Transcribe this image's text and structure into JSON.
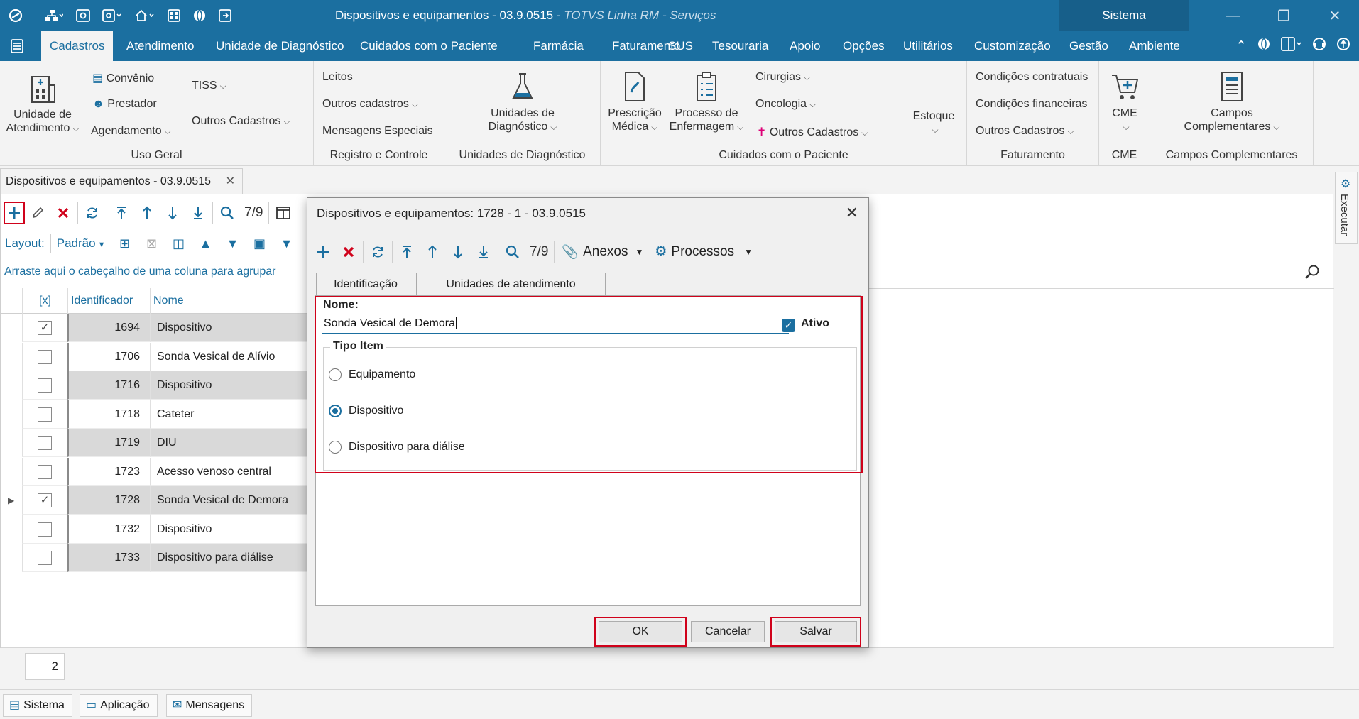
{
  "window": {
    "title": "Dispositivos e equipamentos - 03.9.0515 -",
    "product": "TOTVS Linha RM - Serviços",
    "context": "Sistema"
  },
  "menu": {
    "items": [
      "Cadastros",
      "Atendimento",
      "Unidade de Diagnóstico",
      "Cuidados com o Paciente",
      "Farmácia",
      "Faturamento",
      "SUS",
      "Tesouraria",
      "Apoio",
      "Opções",
      "Utilitários",
      "Customização",
      "Gestão",
      "Ambiente"
    ],
    "active": "Cadastros"
  },
  "ribbon": {
    "uso_geral": {
      "label": "Uso Geral",
      "unidade_line1": "Unidade de",
      "unidade_line2": "Atendimento",
      "convenio": "Convênio",
      "prestador": "Prestador",
      "agendamento": "Agendamento",
      "tiss": "TISS",
      "outros": "Outros Cadastros"
    },
    "registro": {
      "label": "Registro e Controle",
      "leitos": "Leitos",
      "outros": "Outros cadastros",
      "mensagens": "Mensagens Especiais"
    },
    "diagnostico": {
      "label": "Unidades de Diagnóstico",
      "btn_line1": "Unidades de",
      "btn_line2": "Diagnóstico"
    },
    "cuidados": {
      "label": "Cuidados com o Paciente",
      "prescricao_line1": "Prescrição",
      "prescricao_line2": "Médica",
      "processo_line1": "Processo de",
      "processo_line2": "Enfermagem",
      "cirurgias": "Cirurgias",
      "oncologia": "Oncologia",
      "outros": "Outros Cadastros"
    },
    "estoque": {
      "label": "Estoque"
    },
    "faturamento": {
      "label": "Faturamento",
      "contratuais": "Condições contratuais",
      "financeiras": "Condições financeiras",
      "outros": "Outros Cadastros"
    },
    "cme": {
      "label": "CME",
      "btn": "CME"
    },
    "campos": {
      "label": "Campos Complementares",
      "btn_line1": "Campos",
      "btn_line2": "Complementares"
    }
  },
  "doc_tab": {
    "title": "Dispositivos e equipamentos - 03.9.0515"
  },
  "toolbar": {
    "record_counter": "7/9",
    "layout_label": "Layout:",
    "layout_value": "Padrão"
  },
  "grid": {
    "group_hint": "Arraste aqui o cabeçalho de uma coluna para agrupar",
    "columns": [
      "[x]",
      "Identificador",
      "Nome"
    ],
    "rows": [
      {
        "checked": true,
        "id": "1694",
        "name": "Dispositivo"
      },
      {
        "checked": false,
        "id": "1706",
        "name": "Sonda Vesical de Alívio"
      },
      {
        "checked": false,
        "id": "1716",
        "name": "Dispositivo"
      },
      {
        "checked": false,
        "id": "1718",
        "name": "Cateter"
      },
      {
        "checked": false,
        "id": "1719",
        "name": "DIU"
      },
      {
        "checked": false,
        "id": "1723",
        "name": "Acesso venoso central"
      },
      {
        "checked": true,
        "id": "1728",
        "name": "Sonda Vesical de Demora"
      },
      {
        "checked": false,
        "id": "1732",
        "name": "Dispositivo"
      },
      {
        "checked": false,
        "id": "1733",
        "name": "Dispositivo para diálise"
      }
    ],
    "page_number": "2"
  },
  "status_tabs": [
    "Sistema",
    "Aplicação",
    "Mensagens"
  ],
  "side_panel": {
    "label": "Executar"
  },
  "dialog": {
    "title": "Dispositivos e equipamentos: 1728 - 1 - 03.9.0515",
    "record_counter": "7/9",
    "anexos": "Anexos",
    "processos": "Processos",
    "tabs": [
      "Identificação",
      "Unidades de atendimento"
    ],
    "nome_label": "Nome:",
    "nome_value": "Sonda Vesical de Demora",
    "ativo_label": "Ativo",
    "ativo_checked": true,
    "tipo_item_label": "Tipo Item",
    "tipo_options": [
      "Equipamento",
      "Dispositivo",
      "Dispositivo para diálise"
    ],
    "tipo_selected": "Dispositivo",
    "buttons": {
      "ok": "OK",
      "cancel": "Cancelar",
      "save": "Salvar"
    }
  },
  "colors": {
    "brand": "#1b6fa0",
    "highlight": "#d0021b",
    "delete": "#d0021b"
  }
}
